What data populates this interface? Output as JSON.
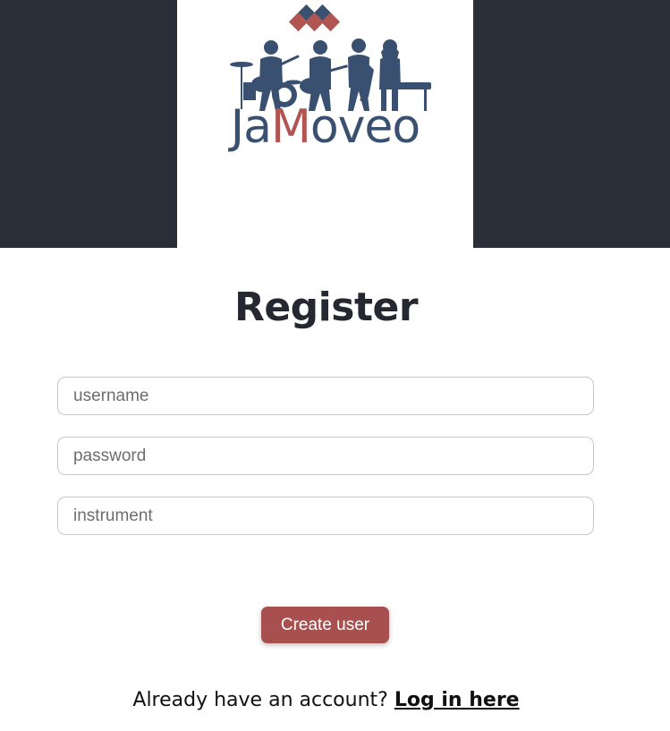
{
  "logo": {
    "brand_part1": "Ja",
    "brand_part2": "M",
    "brand_part3": "oveo",
    "colors": {
      "navy": "#3a5070",
      "accent": "#b15553"
    }
  },
  "header": {
    "background": "#2a2e38"
  },
  "form": {
    "title": "Register",
    "username_placeholder": "username",
    "password_placeholder": "password",
    "instrument_placeholder": "instrument",
    "submit_label": "Create user",
    "submit_color": "#a8504f"
  },
  "footer": {
    "prompt": "Already have an account?",
    "link_label": "Log in here"
  }
}
